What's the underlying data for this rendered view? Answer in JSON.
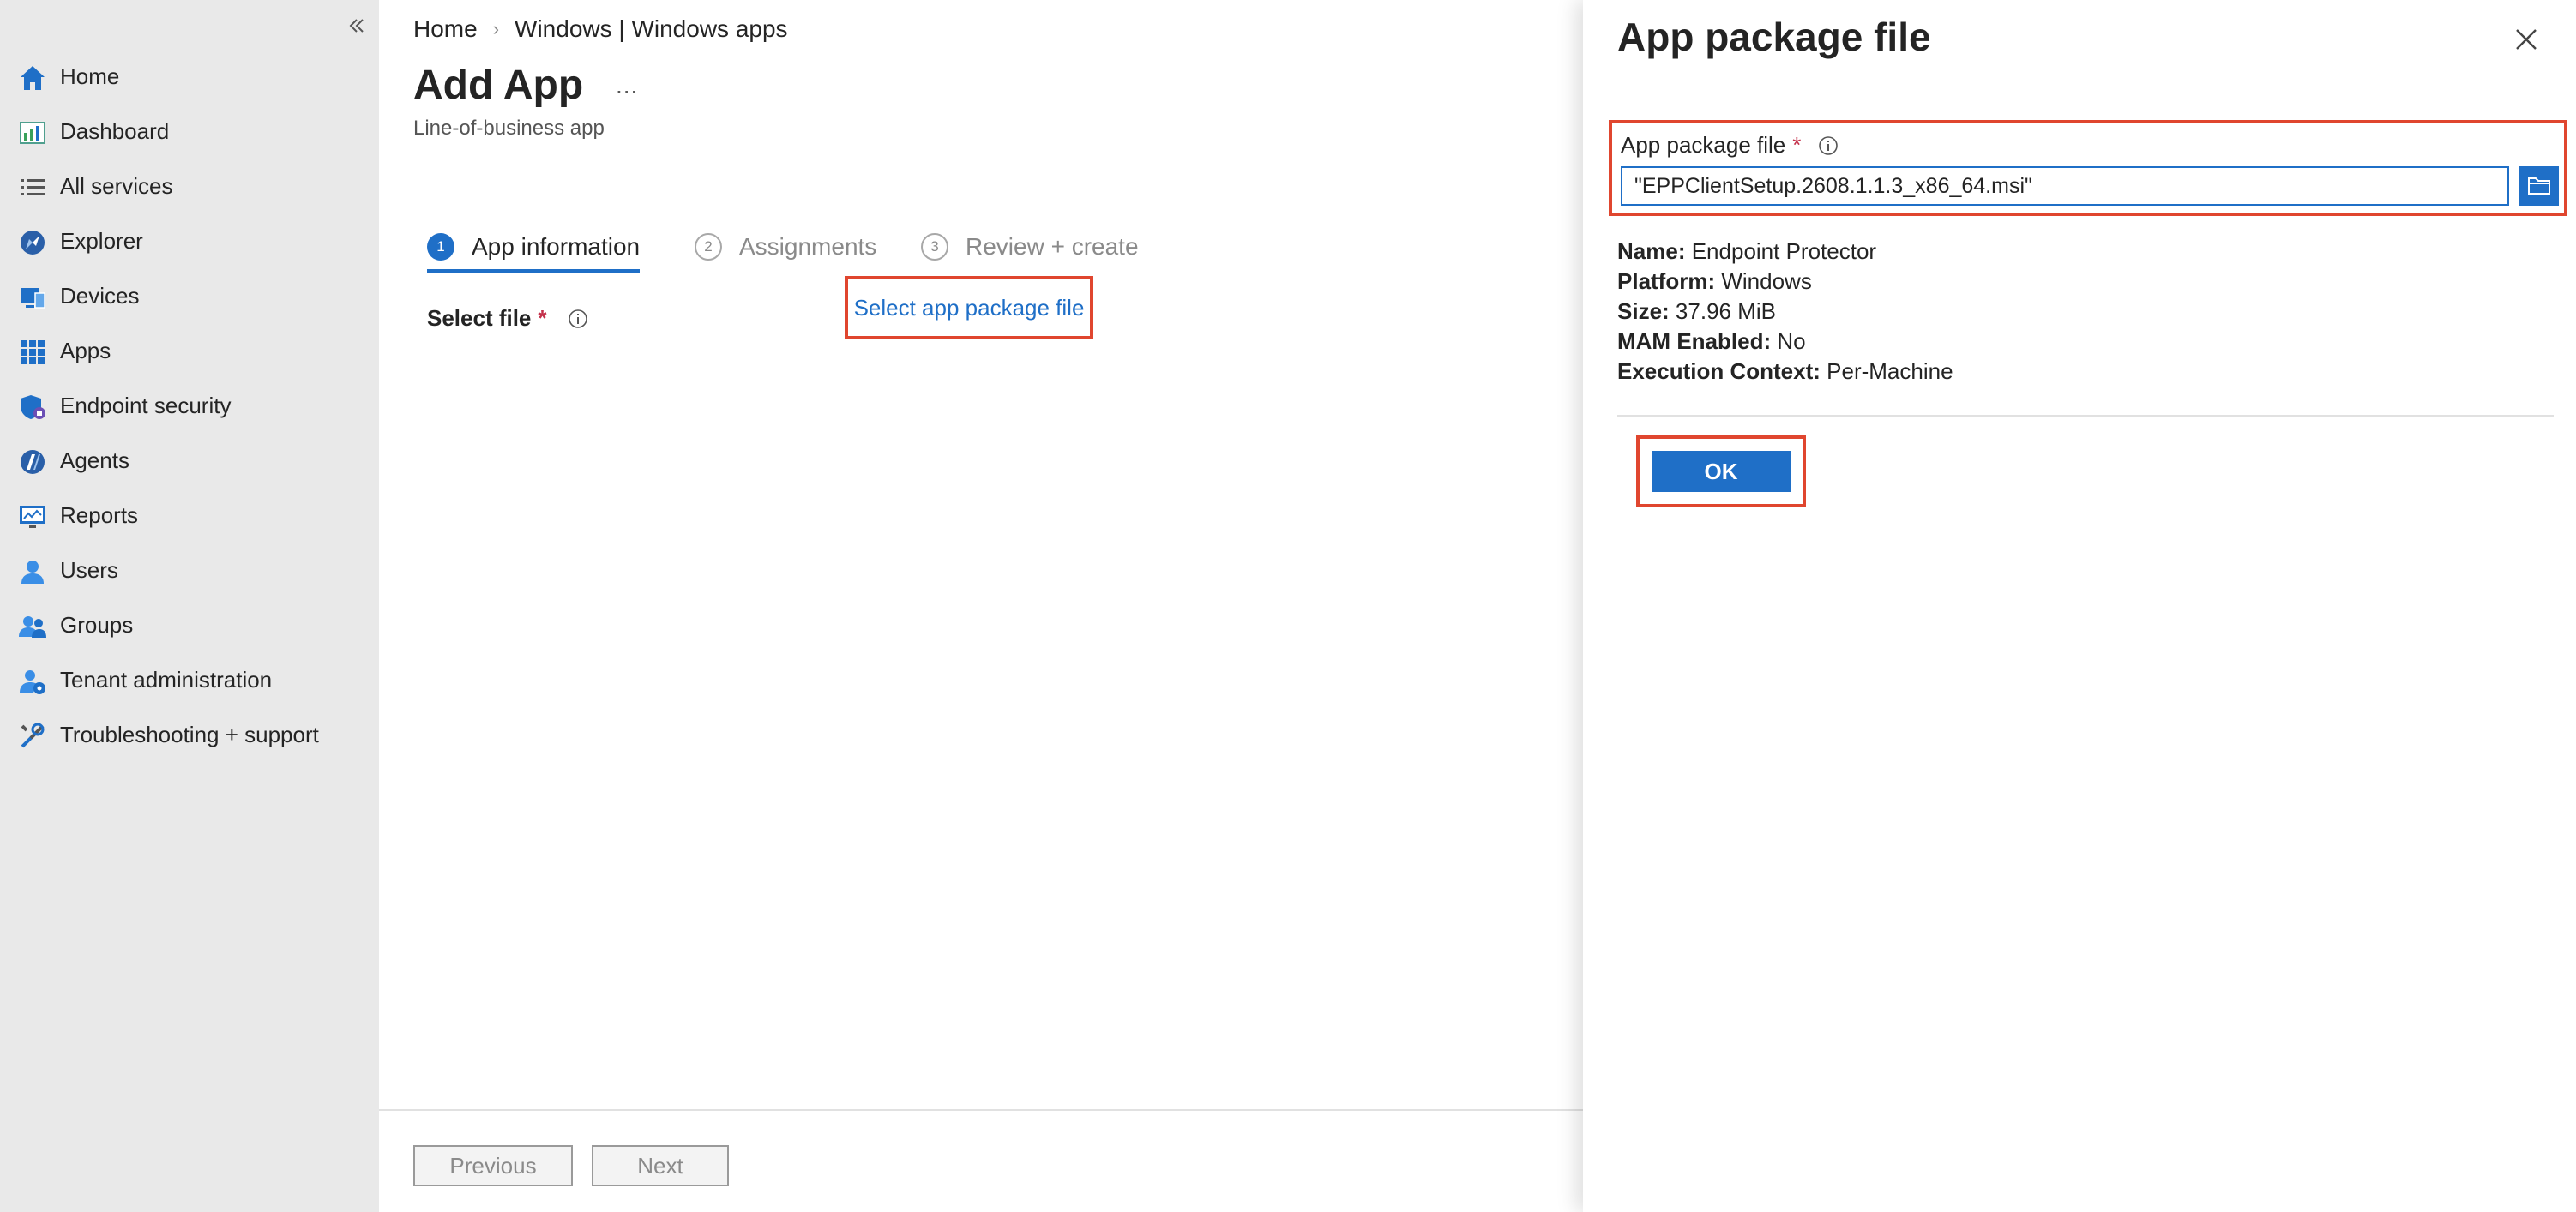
{
  "sidebar": {
    "items": [
      {
        "label": "Home",
        "icon": "home-icon"
      },
      {
        "label": "Dashboard",
        "icon": "dashboard-icon"
      },
      {
        "label": "All services",
        "icon": "list-icon"
      },
      {
        "label": "Explorer",
        "icon": "explorer-icon"
      },
      {
        "label": "Devices",
        "icon": "devices-icon"
      },
      {
        "label": "Apps",
        "icon": "apps-grid-icon"
      },
      {
        "label": "Endpoint security",
        "icon": "shield-icon"
      },
      {
        "label": "Agents",
        "icon": "agents-icon"
      },
      {
        "label": "Reports",
        "icon": "reports-icon"
      },
      {
        "label": "Users",
        "icon": "user-icon"
      },
      {
        "label": "Groups",
        "icon": "groups-icon"
      },
      {
        "label": "Tenant administration",
        "icon": "tenant-admin-icon"
      },
      {
        "label": "Troubleshooting + support",
        "icon": "tools-icon"
      }
    ]
  },
  "header": {
    "breadcrumb": [
      "Home",
      "Windows | Windows apps"
    ],
    "title": "Add App",
    "more": "...",
    "subtitle": "Line-of-business app"
  },
  "steps": [
    {
      "num": "1",
      "label": "App information"
    },
    {
      "num": "2",
      "label": "Assignments"
    },
    {
      "num": "3",
      "label": "Review + create"
    }
  ],
  "form": {
    "select_file_label": "Select file",
    "required": "*",
    "select_link": "Select app package file"
  },
  "footer": {
    "previous": "Previous",
    "next": "Next"
  },
  "panel": {
    "title": "App package file",
    "file_label": "App package file",
    "required": "*",
    "file_value": "\"EPPClientSetup.2608.1.1.3_x86_64.msi\"",
    "details": [
      {
        "key": "Name:",
        "value": "Endpoint Protector"
      },
      {
        "key": "Platform:",
        "value": "Windows"
      },
      {
        "key": "Size:",
        "value": "37.96 MiB"
      },
      {
        "key": "MAM Enabled:",
        "value": "No"
      },
      {
        "key": "Execution Context:",
        "value": "Per-Machine"
      }
    ],
    "ok": "OK"
  },
  "colors": {
    "accent": "#1f6fc7",
    "highlight": "#e0462f",
    "required": "#c4314b",
    "sidebar_bg": "#e9e9e9"
  }
}
